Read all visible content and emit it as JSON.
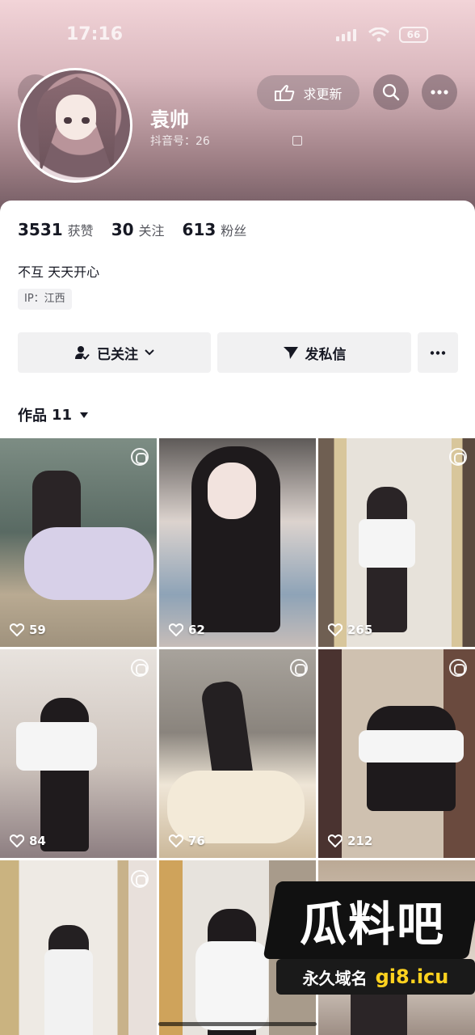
{
  "status_bar": {
    "time": "17:16",
    "battery": "66"
  },
  "profile": {
    "name": "袁帅",
    "douyin_id": "抖音号：26",
    "request_update_label": "求更新"
  },
  "stats": [
    {
      "value": "3531",
      "label": "获赞"
    },
    {
      "value": "30",
      "label": "关注"
    },
    {
      "value": "613",
      "label": "粉丝"
    }
  ],
  "bio": "不互 天天开心",
  "ip": "IP：江西",
  "actions": {
    "follow_label": "已关注",
    "message_label": "发私信"
  },
  "works": {
    "label": "作品",
    "count": "11"
  },
  "posts": [
    {
      "likes": "59"
    },
    {
      "likes": "62"
    },
    {
      "likes": "265"
    },
    {
      "likes": "84"
    },
    {
      "likes": "76"
    },
    {
      "likes": "212"
    },
    {
      "likes": ""
    },
    {
      "likes": ""
    },
    {
      "likes": ""
    }
  ],
  "watermark": {
    "title": "瓜料吧",
    "sub_label": "永久域名",
    "domain": "gi8.icu"
  }
}
